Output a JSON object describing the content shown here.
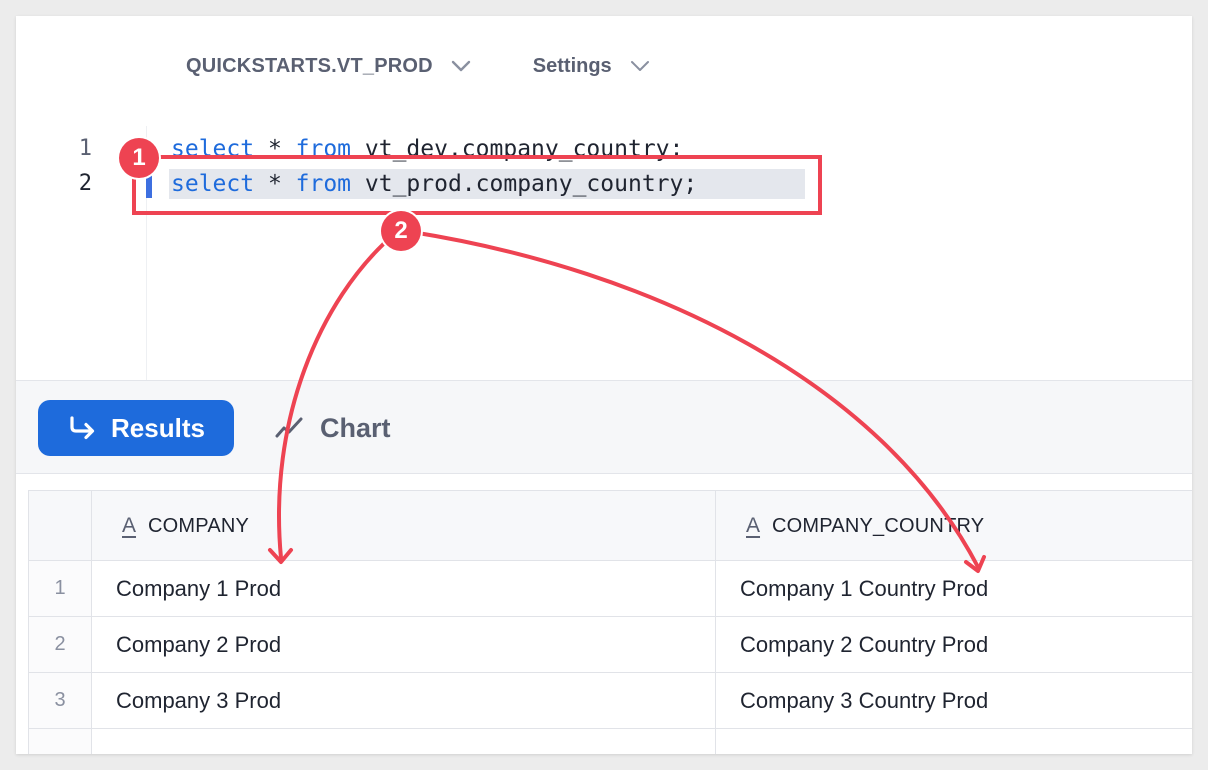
{
  "context_bar": {
    "database": "QUICKSTARTS.VT_PROD",
    "settings": "Settings"
  },
  "editor": {
    "lines": [
      {
        "number": "1",
        "keyword1": "select",
        "mid": " * ",
        "keyword2": "from",
        "rest": " vt_dev.company_country;"
      },
      {
        "number": "2",
        "keyword1": "select",
        "mid": " * ",
        "keyword2": "from",
        "rest": " vt_prod.company_country;"
      }
    ]
  },
  "results_bar": {
    "results_label": "Results",
    "chart_label": "Chart"
  },
  "table": {
    "columns": [
      {
        "type_icon": "A",
        "name": "COMPANY"
      },
      {
        "type_icon": "A",
        "name": "COMPANY_COUNTRY"
      }
    ],
    "rows": [
      {
        "n": "1",
        "company": "Company 1 Prod",
        "country": "Company 1 Country Prod"
      },
      {
        "n": "2",
        "company": "Company 2 Prod",
        "country": "Company 2 Country Prod"
      },
      {
        "n": "3",
        "company": "Company 3 Prod",
        "country": "Company 3 Country Prod"
      }
    ]
  },
  "annotations": {
    "badge1": "1",
    "badge2": "2",
    "color": "#ee4352"
  },
  "colors": {
    "accent": "#1e6bdc",
    "keyword": "#1e6bdc",
    "annotation": "#ee4352"
  }
}
